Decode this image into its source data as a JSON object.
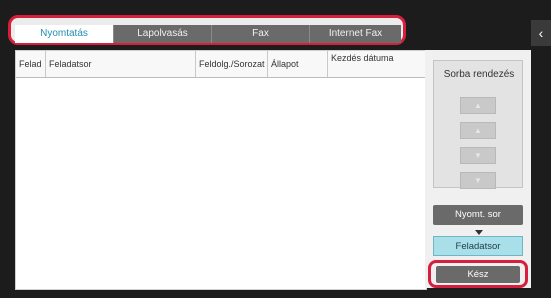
{
  "tabs": [
    {
      "label": "Nyomtatás",
      "active": true
    },
    {
      "label": "Lapolvasás",
      "active": false
    },
    {
      "label": "Fax",
      "active": false
    },
    {
      "label": "Internet Fax",
      "active": false
    }
  ],
  "table": {
    "columns": [
      "Felad",
      "Feladatsor",
      "Feldolg./Sorozat",
      "Állapot",
      "Kezdés dátuma"
    ],
    "rows": []
  },
  "side_panel": {
    "sort_label": "Sorba rendezés",
    "sort_buttons": [
      "sort-up-icon",
      "sort-up-icon",
      "sort-down-icon",
      "sort-down-icon"
    ],
    "print_queue_label": "Nyomt. sor",
    "job_queue_label": "Feladatsor",
    "done_label": "Kész",
    "toggle_icon": "chevron-left-icon"
  },
  "colors": {
    "highlight": "#d51f3c",
    "active_tab_text": "#1f8fb0",
    "selected_button": "#a8dfe8"
  }
}
